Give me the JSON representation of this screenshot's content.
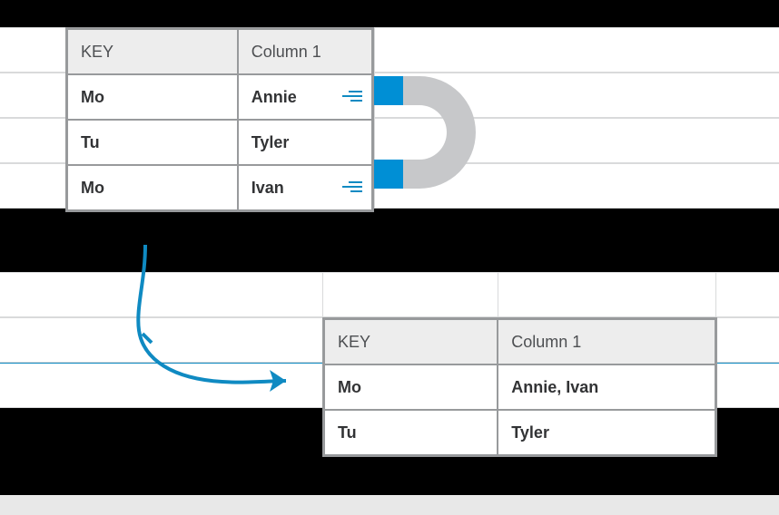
{
  "top_table": {
    "headers": {
      "key": "KEY",
      "col1": "Column 1"
    },
    "rows": [
      {
        "key": "Mo",
        "val": "Annie",
        "highlight": true
      },
      {
        "key": "Tu",
        "val": "Tyler",
        "highlight": false
      },
      {
        "key": "Mo",
        "val": "Ivan",
        "highlight": true
      }
    ]
  },
  "bottom_table": {
    "headers": {
      "key": "KEY",
      "col1": "Column 1"
    },
    "rows": [
      {
        "key": "Mo",
        "val": "Annie, Ivan"
      },
      {
        "key": "Tu",
        "val": "Tyler"
      }
    ]
  },
  "colors": {
    "accent": "#008fd5",
    "magnet": "#c7c8ca"
  }
}
